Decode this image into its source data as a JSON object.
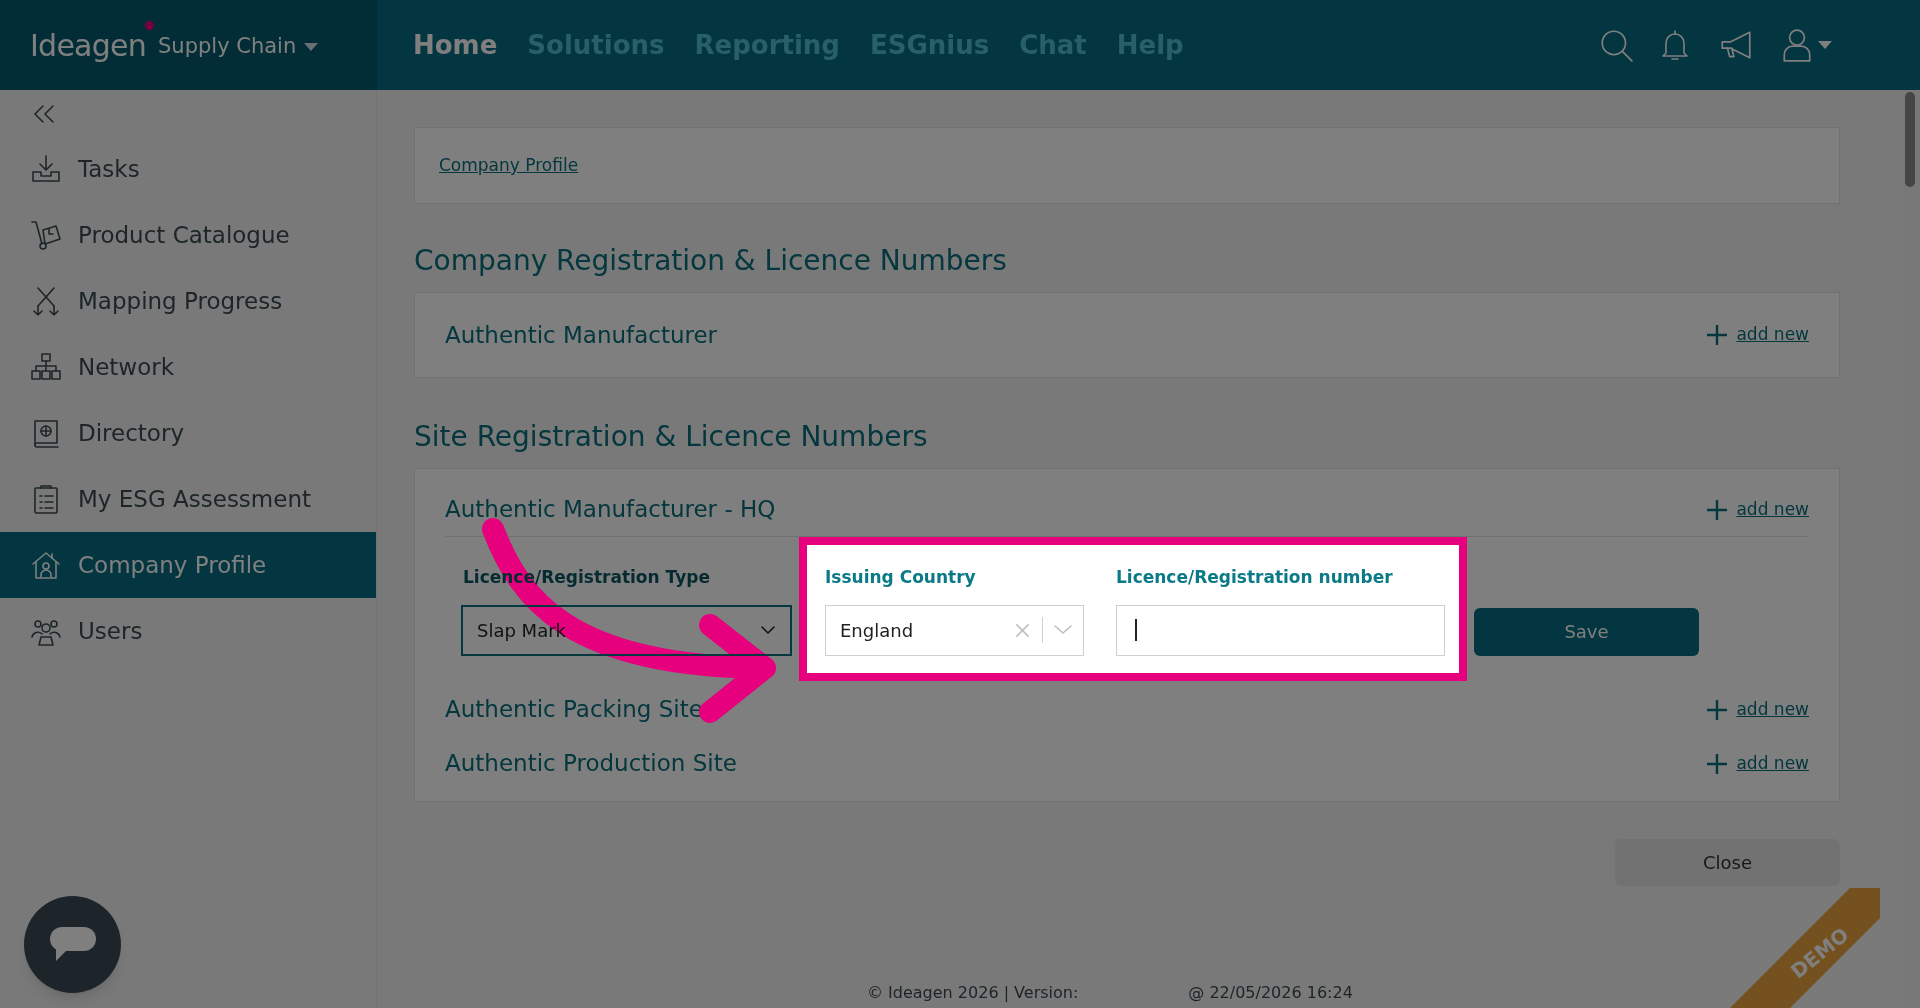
{
  "header": {
    "logo": "Ideagen",
    "product": "Supply Chain",
    "nav": [
      {
        "label": "Home",
        "selected": true
      },
      {
        "label": "Solutions",
        "selected": false
      },
      {
        "label": "Reporting",
        "selected": false
      },
      {
        "label": "ESGnius",
        "selected": false
      },
      {
        "label": "Chat",
        "selected": false
      },
      {
        "label": "Help",
        "selected": false
      }
    ]
  },
  "sidebar": {
    "items": [
      {
        "label": "Tasks",
        "selected": false
      },
      {
        "label": "Product Catalogue",
        "selected": false
      },
      {
        "label": "Mapping Progress",
        "selected": false
      },
      {
        "label": "Network",
        "selected": false
      },
      {
        "label": "Directory",
        "selected": false
      },
      {
        "label": "My ESG Assessment",
        "selected": false
      },
      {
        "label": "Company Profile",
        "selected": true
      },
      {
        "label": "Users",
        "selected": false
      }
    ]
  },
  "breadcrumb": "Company Profile",
  "sections": [
    {
      "title": "Company Registration & Licence Numbers",
      "entries": [
        {
          "name": "Authentic Manufacturer",
          "action": "add new",
          "expanded": false
        }
      ]
    },
    {
      "title": "Site Registration & Licence Numbers",
      "entries": [
        {
          "name": "Authentic Manufacturer - HQ",
          "action": "add new",
          "expanded": true,
          "form": {
            "type_label": "Licence/Registration Type",
            "type_value": "Slap Mark",
            "country_label": "Issuing Country",
            "country_value": "England",
            "number_label": "Licence/Registration number",
            "number_focused": true,
            "save": "Save"
          }
        },
        {
          "name": "Authentic Packing Site",
          "action": "add new",
          "expanded": false
        },
        {
          "name": "Authentic Production Site",
          "action": "add new",
          "expanded": false
        }
      ]
    }
  ],
  "close": "Close",
  "footer": {
    "copyright": "© Ideagen 2026 | Version:",
    "timestamp": "@ 22/05/2026 16:24"
  },
  "ribbon": "DEMO"
}
